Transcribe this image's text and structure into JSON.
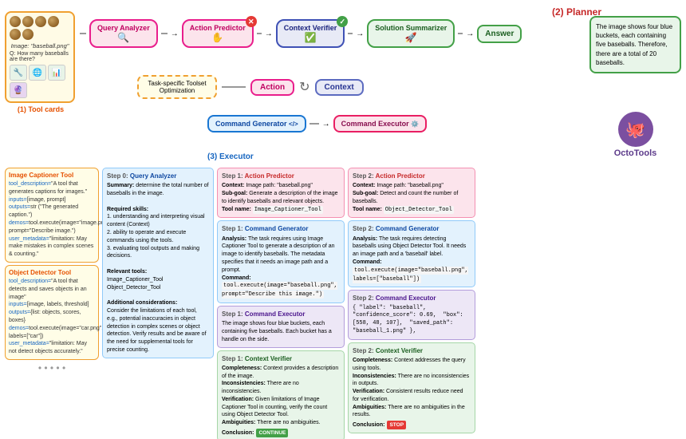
{
  "title": "OctoTools",
  "topDiagram": {
    "inputLabel": "Image: \"baseball.png\"",
    "question": "Q: How many baseballs are there?",
    "nodes": {
      "queryAnalyzer": "Query Analyzer",
      "actionPredictor": "Action Predictor",
      "contextVerifier": "Context Verifier",
      "solutionSummarizer": "Solution Summarizer",
      "action": "Action",
      "context": "Context",
      "commandGenerator": "Command Generator",
      "commandExecutor": "Command Executor"
    },
    "labels": {
      "toolCards": "(1) Tool cards",
      "executor": "(3) Executor",
      "planner": "(2) Planner"
    },
    "taskBox": "Task-specific Toolset Optimization",
    "answer": "Answer",
    "answerText": "The image shows four blue buckets, each containing five baseballs. Therefore, there are a total of 20 baseballs.",
    "octotools": "OctoTools"
  },
  "toolCards": [
    {
      "title": "Image Captioner Tool",
      "fields": [
        {
          "key": "tool_description=",
          "val": "\"A tool that generates captions for images.\""
        },
        {
          "key": "inputs=",
          "val": "[image, prompt]"
        },
        {
          "key": "outputs=",
          "val": "str (\"The generated caption.\")"
        },
        {
          "key": "demos=",
          "val": "tool.execute(image=\"image.png\", prompt=\"Describe image.\")"
        },
        {
          "key": "user_metadata=",
          "val": "\"limitation: May make mistakes in complex scenes & counting.\""
        }
      ]
    },
    {
      "title": "Object Detector Tool",
      "fields": [
        {
          "key": "tool_description=",
          "val": "\"A tool that detects and saves objects in an image\""
        },
        {
          "key": "inputs=",
          "val": "[image, labels, threshold]"
        },
        {
          "key": "outputs=",
          "val": "{list: objects, scores, boxes}"
        },
        {
          "key": "demos=",
          "val": "tool.execute(image=\"car.png\", labels=[\"car\"])"
        },
        {
          "key": "user_metadata=",
          "val": "\"limitation: May not detect objects accurately.\""
        }
      ]
    }
  ],
  "step0": {
    "title": "Step 0: Query Analyzer",
    "summary": "determine the total number of baseballs in the image.",
    "requiredSkills": [
      "1. understanding and interpreting visual content (Context)",
      "2. ability to operate and execute commands using the tools.",
      "3. evaluating tool outputs and making decisions."
    ],
    "relevantTools": [
      "Image_Captioner_Tool",
      "Object_Detector_Tool"
    ],
    "additionalConsiderations": "Consider the limitations of each tool, e.g., potential inaccuracies in object detection in complex scenes or object detection. Verify results and be aware of the need for supplemental tools for precise counting."
  },
  "step1Sections": [
    {
      "type": "action-predictor",
      "title": "Step 1: Action Predictor",
      "context": "Image path: \"baseball.png\"",
      "subgoal": "Generate a description of the image to identify baseballs and relevant objects.",
      "toolName": "Image_Captioner_Tool"
    },
    {
      "type": "command-generator",
      "title": "Step 1: Command Generator",
      "analysis": "The task requires using Image Captioner Tool to generate a description of an image to identify baseballs. The metadata specifies that it needs an image path and a prompt.",
      "command": "tool.execute(image=\"baseball.png\", prompt=\"Describe this image.\")"
    },
    {
      "type": "command-executor",
      "title": "Step 1: Command Executor",
      "result": "The image shows four blue buckets, each containing five baseballs. Each bucket has a handle on the side."
    },
    {
      "type": "context-verifier",
      "title": "Step 1: Context Verifier",
      "completeness": "Context provides a description of the image.",
      "inconsistencies": "There are no inconsistencies.",
      "verification": "Given limitations of Image Captioner Tool in counting, verify the count using Object Detector Tool.",
      "ambiguities": "There are no ambiguities.",
      "conclusion": "CONTINUE",
      "conclusionType": "continue"
    }
  ],
  "step2Sections": [
    {
      "type": "action-predictor",
      "title": "Step 2: Action Predictor",
      "context": "Image path: \"baseball.png\"",
      "subgoal": "Detect and count the number of baseballs.",
      "toolName": "Object_Detector_Tool"
    },
    {
      "type": "command-generator",
      "title": "Step 2: Command Generator",
      "analysis": "The task requires detecting baseballs using Object Detector Tool. It needs an image path and a 'baseball' label.",
      "command": "tool.execute(image=\"baseball.png\", labels=[\"baseball\"])"
    },
    {
      "type": "command-executor",
      "title": "Step 2: Command Executor",
      "result": "{\n  \"label\": \"baseball\",\n  \"confidence_score\": 0.69,\n  \"box\": [558, 48, 107],\n  \"saved_path\": \"baseball_1.png\"\n},"
    },
    {
      "type": "context-verifier",
      "title": "Step 2: Context Verifier",
      "completeness": "Context addresses the query using tools.",
      "inconsistencies": "There are no inconsistencies in outputs.",
      "verification": "Consistent results reduce need for verification.",
      "ambiguities": "There are no ambiguities in the results.",
      "conclusion": "STOP",
      "conclusionType": "stop"
    }
  ]
}
